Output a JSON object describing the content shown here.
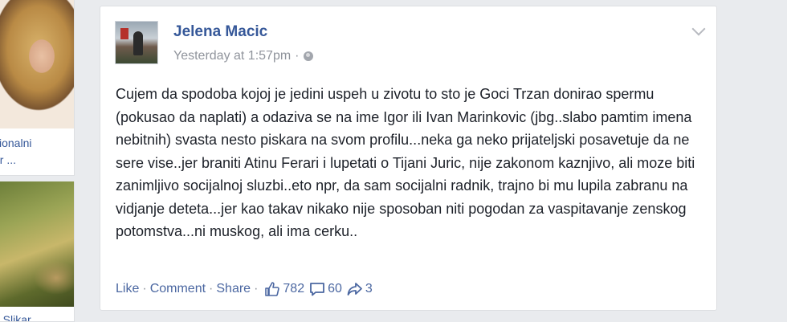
{
  "sidebar": {
    "card1": {
      "line1": "cionalni",
      "line2": "er ..."
    },
    "card2": {
      "line1": "o Slikar"
    }
  },
  "post": {
    "author": "Jelena Macic",
    "timestamp": "Yesterday at 1:57pm",
    "separator": "·",
    "privacy_icon": "globe-icon",
    "menu_icon": "chevron-down-icon",
    "body": "Cujem da spodoba kojoj je jedini uspeh u zivotu to sto je Goci Trzan donirao spermu (pokusao da naplati) a odaziva se na ime Igor ili Ivan Marinkovic (jbg..slabo pamtim imena nebitnih) svasta nesto piskara na svom profilu...neka ga neko prijateljski posavetuje da ne sere vise..jer braniti Atinu Ferari i lupetati o Tijani Juric, nije zakonom kaznjivo, ali moze biti zanimljivo socijalnoj sluzbi..eto npr, da sam socijalni radnik, trajno bi mu lupila zabranu na vidjanje deteta...jer kao takav nikako nije sposoban niti pogodan za vaspitavanje zenskog potomstva...ni muskog, ali ima cerku.."
  },
  "actions": {
    "like": "Like",
    "comment": "Comment",
    "share": "Share",
    "separator": "·",
    "likes_count": "782",
    "comments_count": "60",
    "shares_count": "3"
  },
  "colors": {
    "link": "#365899",
    "muted": "#90949c",
    "background": "#e9ebee"
  }
}
